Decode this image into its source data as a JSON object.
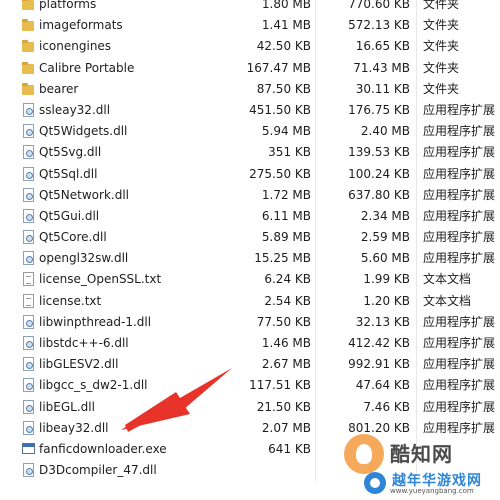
{
  "files": [
    {
      "name": "platforms",
      "size": "1.80 MB",
      "packed": "770.60 KB",
      "type": "文件夹",
      "icon": "folder-icon"
    },
    {
      "name": "imageformats",
      "size": "1.41 MB",
      "packed": "572.13 KB",
      "type": "文件夹",
      "icon": "folder-icon"
    },
    {
      "name": "iconengines",
      "size": "42.50 KB",
      "packed": "16.65 KB",
      "type": "文件夹",
      "icon": "folder-icon"
    },
    {
      "name": "Calibre Portable",
      "size": "167.47 MB",
      "packed": "71.43 MB",
      "type": "文件夹",
      "icon": "folder-icon"
    },
    {
      "name": "bearer",
      "size": "87.50 KB",
      "packed": "30.11 KB",
      "type": "文件夹",
      "icon": "folder-icon"
    },
    {
      "name": "ssleay32.dll",
      "size": "451.50 KB",
      "packed": "176.75 KB",
      "type": "应用程序扩展",
      "icon": "dll-file-icon"
    },
    {
      "name": "Qt5Widgets.dll",
      "size": "5.94 MB",
      "packed": "2.40 MB",
      "type": "应用程序扩展",
      "icon": "dll-file-icon"
    },
    {
      "name": "Qt5Svg.dll",
      "size": "351 KB",
      "packed": "139.53 KB",
      "type": "应用程序扩展",
      "icon": "dll-file-icon"
    },
    {
      "name": "Qt5Sql.dll",
      "size": "275.50 KB",
      "packed": "100.24 KB",
      "type": "应用程序扩展",
      "icon": "dll-file-icon"
    },
    {
      "name": "Qt5Network.dll",
      "size": "1.72 MB",
      "packed": "637.80 KB",
      "type": "应用程序扩展",
      "icon": "dll-file-icon"
    },
    {
      "name": "Qt5Gui.dll",
      "size": "6.11 MB",
      "packed": "2.34 MB",
      "type": "应用程序扩展",
      "icon": "dll-file-icon"
    },
    {
      "name": "Qt5Core.dll",
      "size": "5.89 MB",
      "packed": "2.59 MB",
      "type": "应用程序扩展",
      "icon": "dll-file-icon"
    },
    {
      "name": "opengl32sw.dll",
      "size": "15.25 MB",
      "packed": "5.60 MB",
      "type": "应用程序扩展",
      "icon": "dll-file-icon"
    },
    {
      "name": "license_OpenSSL.txt",
      "size": "6.24 KB",
      "packed": "1.99 KB",
      "type": "文本文档",
      "icon": "text-file-icon"
    },
    {
      "name": "license.txt",
      "size": "2.54 KB",
      "packed": "1.20 KB",
      "type": "文本文档",
      "icon": "text-file-icon"
    },
    {
      "name": "libwinpthread-1.dll",
      "size": "77.50 KB",
      "packed": "32.13 KB",
      "type": "应用程序扩展",
      "icon": "dll-file-icon"
    },
    {
      "name": "libstdc++-6.dll",
      "size": "1.46 MB",
      "packed": "412.42 KB",
      "type": "应用程序扩展",
      "icon": "dll-file-icon"
    },
    {
      "name": "libGLESV2.dll",
      "size": "2.67 MB",
      "packed": "992.91 KB",
      "type": "应用程序扩展",
      "icon": "dll-file-icon"
    },
    {
      "name": "libgcc_s_dw2-1.dll",
      "size": "117.51 KB",
      "packed": "47.64 KB",
      "type": "应用程序扩展",
      "icon": "dll-file-icon"
    },
    {
      "name": "libEGL.dll",
      "size": "21.50 KB",
      "packed": "7.46 KB",
      "type": "应用程序扩展",
      "icon": "dll-file-icon"
    },
    {
      "name": "libeay32.dll",
      "size": "2.07 MB",
      "packed": "801.20 KB",
      "type": "应用程序扩展",
      "icon": "dll-file-icon"
    },
    {
      "name": "fanficdownloader.exe",
      "size": "641 KB",
      "packed": "",
      "type": "",
      "icon": "exe-file-icon"
    },
    {
      "name": "D3Dcompiler_47.dll",
      "size": "",
      "packed": "",
      "type": "",
      "icon": "dll-file-icon"
    }
  ],
  "watermark": {
    "brand": "酷知网",
    "site_name": "越年华游戏网",
    "url": "www.yueyangbang.com"
  },
  "colors": {
    "arrow": "#e8332a",
    "folder": "#e8bd4f",
    "selected_row": "#e5f1fb"
  }
}
